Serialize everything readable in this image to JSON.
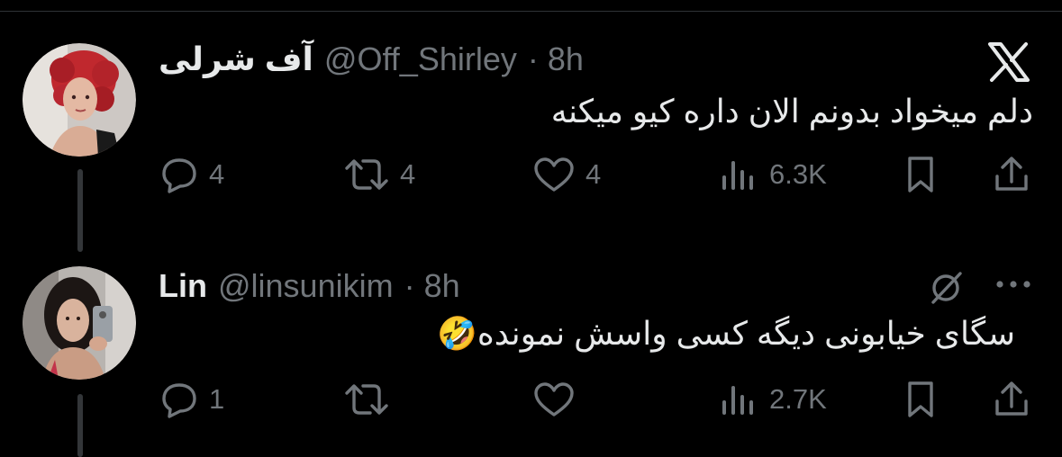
{
  "tweets": [
    {
      "display_name": "آف شرلی",
      "handle": "@Off_Shirley",
      "time": "· 8h",
      "text": "دلم میخواد بدونم الان داره کیو میکنه",
      "replies": "4",
      "reposts": "4",
      "likes": "4",
      "views": "6.3K"
    },
    {
      "display_name": "Lin",
      "handle": "@linsunikim",
      "time": "· 8h",
      "text": "سگای خیابونی دیگه کسی واسش نمونده🤣",
      "replies": "1",
      "reposts": "",
      "likes": "",
      "views": "2.7K"
    }
  ],
  "icons": {
    "brand": "x-logo-icon",
    "reply": "reply-icon",
    "repost": "repost-icon",
    "like": "heart-icon",
    "views": "views-icon",
    "bookmark": "bookmark-icon",
    "share": "share-icon",
    "grok": "grok-icon",
    "more": "more-icon"
  },
  "colors": {
    "background": "#000000",
    "primary_text": "#e7e9ea",
    "secondary_text": "#71767b",
    "divider": "#2f3336"
  }
}
